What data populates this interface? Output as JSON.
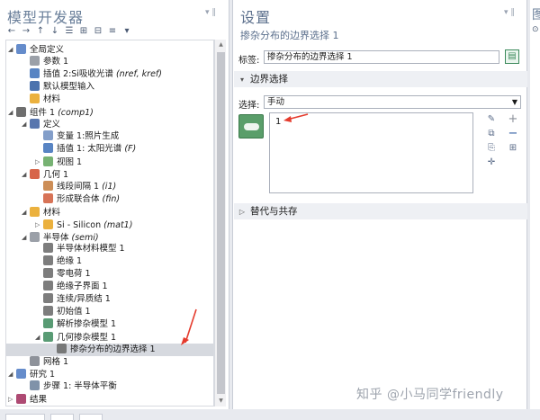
{
  "left_panel": {
    "title": "模型开发器",
    "pin": "▾ ‖",
    "toolbar": [
      "←",
      "→",
      "↑",
      "↓",
      "☰",
      "⊞",
      "⊟",
      "≡",
      "▾"
    ],
    "tree": [
      {
        "id": "global",
        "indent": 0,
        "toggle": "◢",
        "icon": "globe-icon",
        "color": "#4a78c2",
        "label": "全局定义",
        "suffix": ""
      },
      {
        "id": "params",
        "indent": 1,
        "toggle": "",
        "icon": "param-icon",
        "color": "#8a8f99",
        "label": "参数 1",
        "suffix": ""
      },
      {
        "id": "interp2",
        "indent": 1,
        "toggle": "",
        "icon": "interp-icon",
        "color": "#3b6fb8",
        "label": "插值 2:Si吸收光谱 ",
        "suffix": "(nref, kref)"
      },
      {
        "id": "default-input",
        "indent": 1,
        "toggle": "",
        "icon": "input-icon",
        "color": "#2d5aa0",
        "label": "默认模型输入",
        "suffix": ""
      },
      {
        "id": "materials-global",
        "indent": 1,
        "toggle": "",
        "icon": "material-icon",
        "color": "#e8a31c",
        "label": "材料",
        "suffix": ""
      },
      {
        "id": "comp1",
        "indent": 0,
        "toggle": "◢",
        "icon": "component-icon",
        "color": "#555",
        "label": "组件 1 ",
        "suffix": "(comp1)"
      },
      {
        "id": "definitions",
        "indent": 1,
        "toggle": "◢",
        "icon": "definitions-icon",
        "color": "#3b5ea0",
        "label": "定义",
        "suffix": ""
      },
      {
        "id": "var1",
        "indent": 2,
        "toggle": "",
        "icon": "variable-icon",
        "color": "#6d8dbf",
        "label": "变量 1:照片生成",
        "suffix": ""
      },
      {
        "id": "interp1",
        "indent": 2,
        "toggle": "",
        "icon": "interp-icon",
        "color": "#3b6fb8",
        "label": "插值 1: 太阳光谱 ",
        "suffix": "(F)"
      },
      {
        "id": "view1",
        "indent": 2,
        "toggle": "▷",
        "icon": "view-icon",
        "color": "#5fa55a",
        "label": "视图 1",
        "suffix": ""
      },
      {
        "id": "geom1",
        "indent": 1,
        "toggle": "◢",
        "icon": "geometry-icon",
        "color": "#d04a2a",
        "label": "几何 1",
        "suffix": ""
      },
      {
        "id": "interval1",
        "indent": 2,
        "toggle": "",
        "icon": "interval-icon",
        "color": "#c47a3a",
        "label": "线段间隔 1 ",
        "suffix": "(i1)"
      },
      {
        "id": "union",
        "indent": 2,
        "toggle": "",
        "icon": "union-icon",
        "color": "#d05a3a",
        "label": "形成联合体 ",
        "suffix": "(fin)"
      },
      {
        "id": "materials",
        "indent": 1,
        "toggle": "◢",
        "icon": "material-icon",
        "color": "#e8a31c",
        "label": "材料",
        "suffix": ""
      },
      {
        "id": "si",
        "indent": 2,
        "toggle": "▷",
        "icon": "material-icon",
        "color": "#e8a31c",
        "label": "Si - Silicon ",
        "suffix": "(mat1)"
      },
      {
        "id": "semi",
        "indent": 1,
        "toggle": "◢",
        "icon": "semiconductor-icon",
        "color": "#8a8f99",
        "label": "半导体 ",
        "suffix": "(semi)"
      },
      {
        "id": "semimat",
        "indent": 2,
        "toggle": "",
        "icon": "node-icon",
        "color": "#666",
        "label": "半导体材料模型 1",
        "suffix": ""
      },
      {
        "id": "insul",
        "indent": 2,
        "toggle": "",
        "icon": "node-icon",
        "color": "#666",
        "label": "绝缘 1",
        "suffix": ""
      },
      {
        "id": "zerocharge",
        "indent": 2,
        "toggle": "",
        "icon": "node-icon",
        "color": "#666",
        "label": "零电荷 1",
        "suffix": ""
      },
      {
        "id": "insulint",
        "indent": 2,
        "toggle": "",
        "icon": "node-icon",
        "color": "#666",
        "label": "绝缘子界面 1",
        "suffix": ""
      },
      {
        "id": "continuity",
        "indent": 2,
        "toggle": "",
        "icon": "node-icon",
        "color": "#666",
        "label": "连续/异质结 1",
        "suffix": ""
      },
      {
        "id": "init",
        "indent": 2,
        "toggle": "",
        "icon": "node-icon",
        "color": "#666",
        "label": "初始值 1",
        "suffix": ""
      },
      {
        "id": "analytic",
        "indent": 2,
        "toggle": "",
        "icon": "line-icon",
        "color": "#3c8a5c",
        "label": "解析掺杂模型 1",
        "suffix": ""
      },
      {
        "id": "geomdop",
        "indent": 2,
        "toggle": "◢",
        "icon": "line-icon",
        "color": "#3c8a5c",
        "label": "几何掺杂模型 1",
        "suffix": ""
      },
      {
        "id": "boundary-sel",
        "indent": 3,
        "toggle": "",
        "icon": "node-icon",
        "color": "#666",
        "label": "掺杂分布的边界选择 1",
        "suffix": "",
        "selected": true
      },
      {
        "id": "mesh1",
        "indent": 1,
        "toggle": "",
        "icon": "mesh-icon",
        "color": "#7a7f88",
        "label": "网格 1",
        "suffix": ""
      },
      {
        "id": "study1",
        "indent": 0,
        "toggle": "◢",
        "icon": "study-icon",
        "color": "#4a78c2",
        "label": "研究 1",
        "suffix": ""
      },
      {
        "id": "step1",
        "indent": 1,
        "toggle": "",
        "icon": "step-icon",
        "color": "#6a7f9a",
        "label": "步骤 1: 半导体平衡",
        "suffix": ""
      },
      {
        "id": "results",
        "indent": 0,
        "toggle": "▷",
        "icon": "results-icon",
        "color": "#a02a5a",
        "label": "结果",
        "suffix": ""
      }
    ]
  },
  "settings": {
    "title": "设置",
    "pin": "▾ ‖",
    "subtitle": "掺杂分布的边界选择 1",
    "label_caption": "标签:",
    "label_value": "掺杂分布的边界选择 1",
    "section1": "边界选择",
    "selection_caption": "选择:",
    "selection_value": "手动",
    "list_item": "1",
    "side_buttons": [
      "✎",
      "⧉",
      "⎘",
      "✛"
    ],
    "plus": "+",
    "minus": "−",
    "section2": "替代与共存"
  },
  "right_panel": {
    "title": "图",
    "icon": "⊙"
  },
  "watermark": "知乎 @小马同学friendly"
}
